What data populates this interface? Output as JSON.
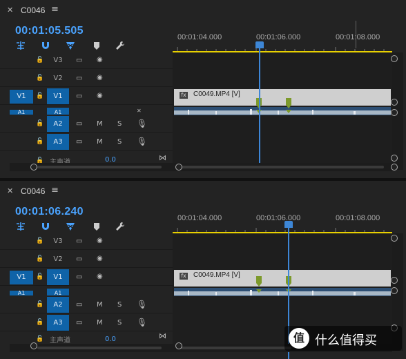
{
  "panels": [
    {
      "seq_name": "C0046",
      "timecode": "00:01:05.505",
      "ruler_labels": [
        "00:01:04.000",
        "00:01:06.000",
        "00:01:08.000"
      ],
      "tracks": {
        "video": [
          "V3",
          "V2",
          "V1"
        ],
        "audio": [
          "A1",
          "A2",
          "A3"
        ],
        "source_video": "V1",
        "source_audio": "A1"
      },
      "clip_name": "C0049.MP4 [V]",
      "audio_toggles": [
        "M",
        "S"
      ],
      "mix_label": "主声道",
      "mix_value": "0.0"
    },
    {
      "seq_name": "C0046",
      "timecode": "00:01:06.240",
      "ruler_labels": [
        "00:01:04.000",
        "00:01:06.000",
        "00:01:08.000"
      ],
      "tracks": {
        "video": [
          "V3",
          "V2",
          "V1"
        ],
        "audio": [
          "A1",
          "A2",
          "A3"
        ],
        "source_video": "V1",
        "source_audio": "A1"
      },
      "clip_name": "C0049.MP4 [V]",
      "audio_toggles": [
        "M",
        "S"
      ],
      "mix_label": "主声道",
      "mix_value": "0.0"
    }
  ],
  "icons": [
    "close-icon",
    "menu-icon",
    "ripple-icon",
    "magnet-icon",
    "linked-icon",
    "marker-icon",
    "wrench-icon",
    "lock-icon",
    "film-icon",
    "eye-icon",
    "mic-icon",
    "fx-icon"
  ],
  "colors": {
    "accent": "#4aa3ff",
    "track_selected": "#0f63a8",
    "work_area": "#e8d000",
    "keyframe": "#7d9a2c",
    "clip": "#cfcfcf"
  },
  "watermark": "什么值得买"
}
